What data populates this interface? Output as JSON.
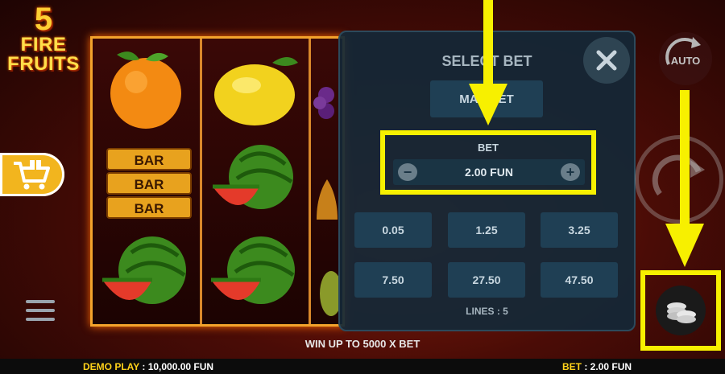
{
  "logo": {
    "number": "5",
    "line1": "FIRE",
    "line2": "FRUITS"
  },
  "panel": {
    "title": "SELECT BET",
    "max_bet": "MAX BET",
    "bet_label": "BET",
    "bet_value": "2.00 FUN",
    "minus": "−",
    "plus": "+",
    "options": [
      "0.05",
      "1.25",
      "3.25",
      "7.50",
      "27.50",
      "47.50"
    ],
    "lines": "LINES : 5"
  },
  "controls": {
    "auto_label": "AUTO"
  },
  "footer": {
    "win_text": "WIN UP TO 5000 X BET",
    "demo_label": "DEMO PLAY",
    "demo_value": ": 10,000.00 FUN",
    "bet_label": "BET",
    "bet_value": ": 2.00 FUN"
  },
  "colors": {
    "highlight": "#f7f000",
    "accent": "#ffd21a",
    "panel": "#142837"
  },
  "icons": [
    "shop-cart-icon",
    "menu-icon",
    "close-icon",
    "auto-icon",
    "spin-icon",
    "coins-icon",
    "arrow-down-icon"
  ],
  "reels": {
    "symbols": [
      [
        "orange",
        "lemon",
        "grapes"
      ],
      [
        "bar",
        "watermelon",
        "bell"
      ],
      [
        "watermelon",
        "watermelon",
        "melon"
      ]
    ]
  }
}
